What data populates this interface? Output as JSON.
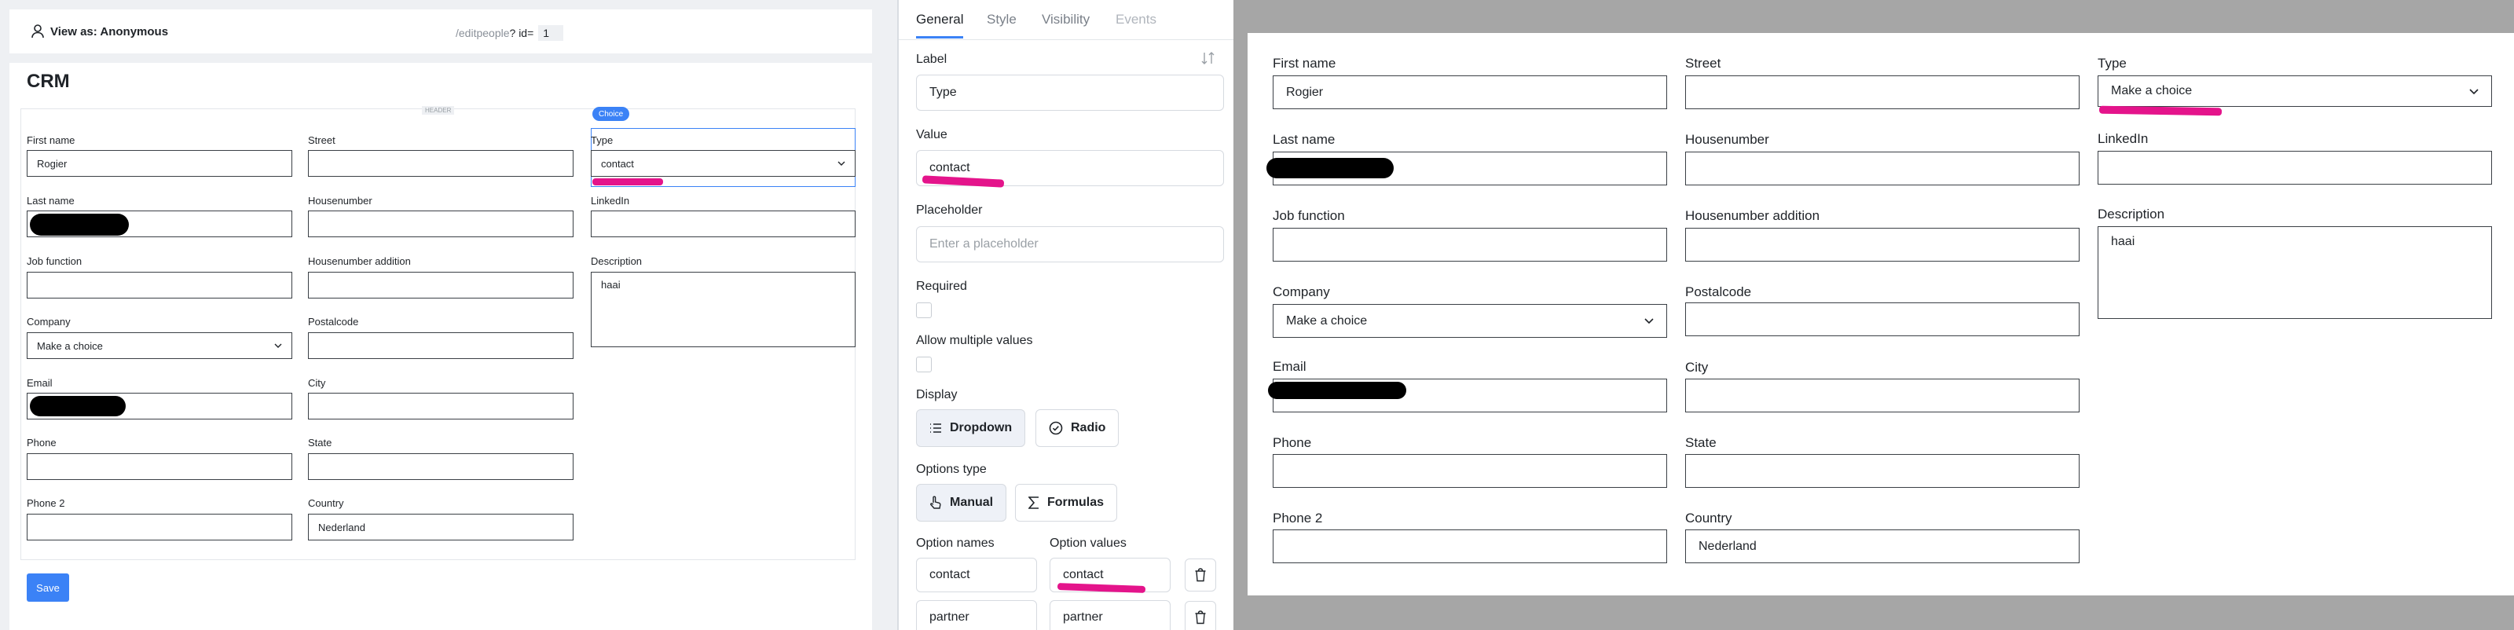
{
  "topbar": {
    "view_as": "View as: Anonymous",
    "url_path": "/editpeople",
    "url_query": "? id=",
    "url_id": "1"
  },
  "page": {
    "title": "CRM",
    "header_tag": "HEADER",
    "choice_badge": "Choice",
    "save_label": "Save"
  },
  "form": {
    "first_name": {
      "label": "First name",
      "value": "Rogier"
    },
    "last_name": {
      "label": "Last name"
    },
    "job_function": {
      "label": "Job function"
    },
    "company": {
      "label": "Company",
      "value": "Make a choice"
    },
    "email": {
      "label": "Email"
    },
    "phone": {
      "label": "Phone"
    },
    "phone2": {
      "label": "Phone 2"
    },
    "street": {
      "label": "Street"
    },
    "housenumber": {
      "label": "Housenumber"
    },
    "housenumber_addition": {
      "label": "Housenumber addition"
    },
    "postalcode": {
      "label": "Postalcode"
    },
    "city": {
      "label": "City"
    },
    "state": {
      "label": "State"
    },
    "country": {
      "label": "Country",
      "value": "Nederland"
    },
    "type": {
      "label": "Type",
      "value_editor": "contact",
      "value_preview": "Make a choice"
    },
    "linkedin": {
      "label": "LinkedIn"
    },
    "description": {
      "label": "Description",
      "value": "haai"
    }
  },
  "inspector": {
    "tabs": [
      "General",
      "Style",
      "Visibility",
      "Events"
    ],
    "label_title": "Label",
    "label_value": "Type",
    "value_title": "Value",
    "value_value": "contact",
    "placeholder_title": "Placeholder",
    "placeholder_hint": "Enter a placeholder",
    "required_title": "Required",
    "multiple_title": "Allow multiple values",
    "display_title": "Display",
    "display_dropdown": "Dropdown",
    "display_radio": "Radio",
    "options_type_title": "Options type",
    "options_manual": "Manual",
    "options_formulas": "Formulas",
    "option_names_title": "Option names",
    "option_values_title": "Option values",
    "options": [
      {
        "name": "contact",
        "value": "contact"
      },
      {
        "name": "partner",
        "value": "partner"
      }
    ]
  },
  "colors": {
    "accent": "#3b82f6",
    "highlight": "#e4148b",
    "redaction": "#000000"
  }
}
